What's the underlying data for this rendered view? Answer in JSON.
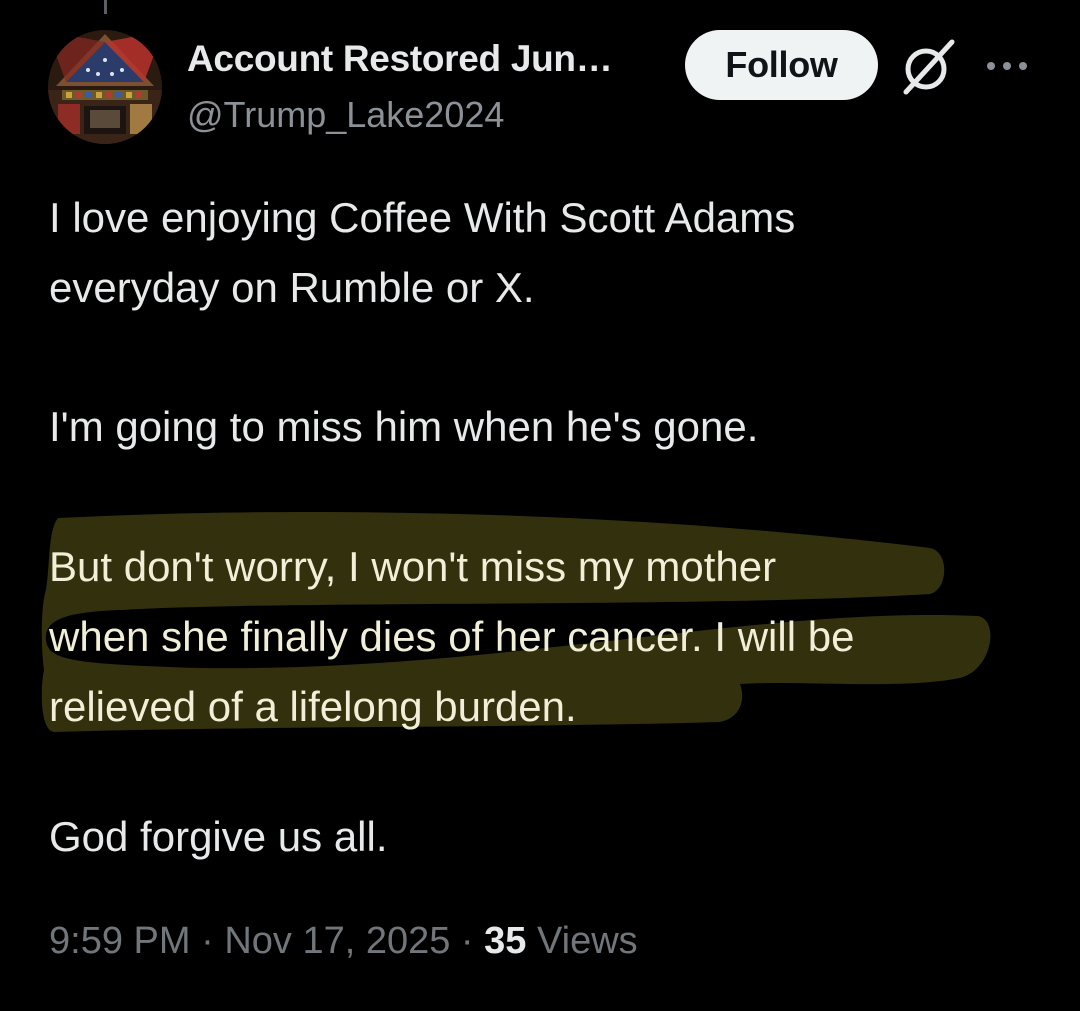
{
  "author": {
    "display_name": "Account Restored Jun…",
    "handle": "@Trump_Lake2024",
    "avatar_icon": "flag-case-avatar"
  },
  "header": {
    "follow_label": "Follow",
    "grok_icon": "grok-icon",
    "more_icon": "more-icon"
  },
  "tweet": {
    "paragraph_1": "I love enjoying Coffee With Scott Adams\neveryday on Rumble or X.",
    "paragraph_2": "I'm going to miss him when he's gone.",
    "paragraph_3": "But don't worry, I won't miss my mother\nwhen she finally dies of her cancer. I will be\nrelieved of a lifelong burden.",
    "paragraph_4": "God forgive us all."
  },
  "meta": {
    "time": "9:59 PM",
    "separator": " · ",
    "date": "Nov 17, 2025",
    "views_count": "35",
    "views_label": " Views"
  },
  "colors": {
    "background": "#000000",
    "text": "#e7e9ea",
    "muted": "#71767b",
    "highlight": "#33300d",
    "follow_bg": "#eff3f4"
  }
}
